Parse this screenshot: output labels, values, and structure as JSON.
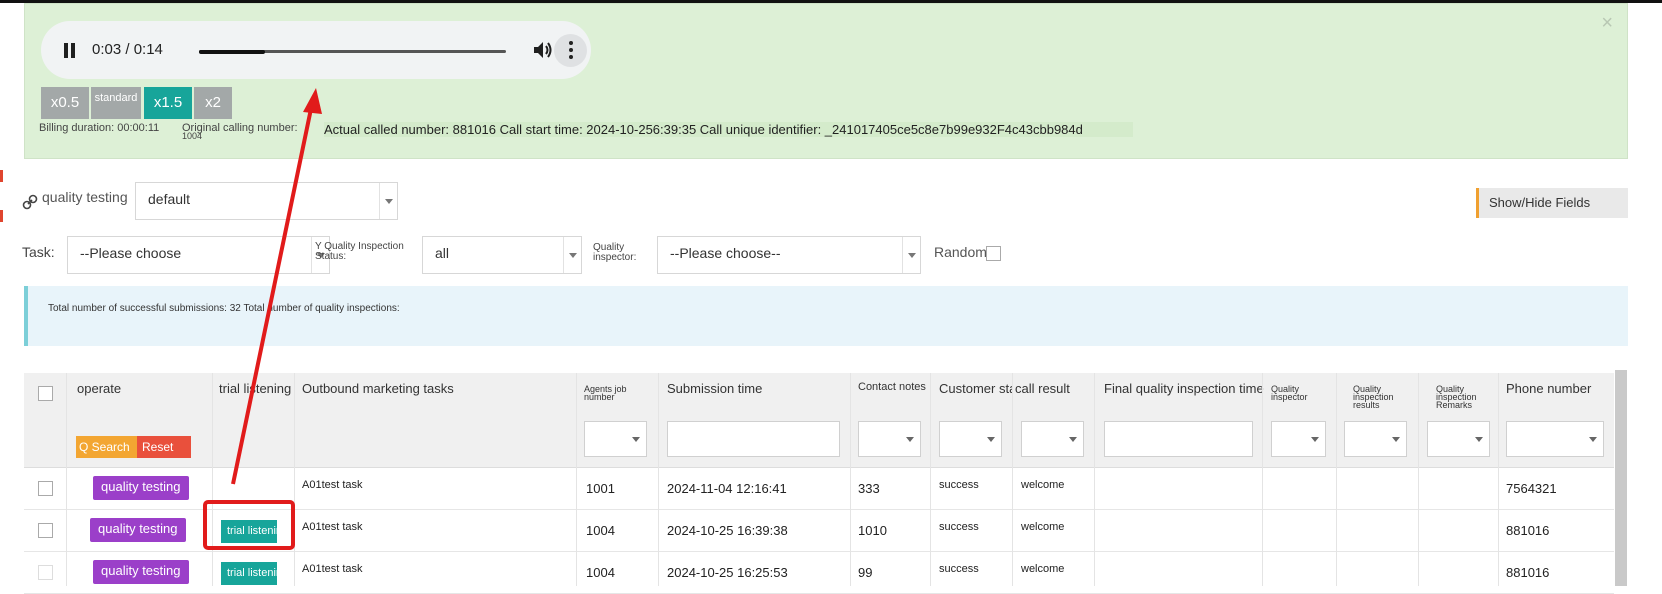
{
  "player": {
    "time": "0:03 / 0:14",
    "progress": 0.214,
    "speeds": [
      "x0.5",
      "standard",
      "x1.5",
      "x2"
    ],
    "billing": "Billing duration: 00:00:11",
    "original_label": "Original calling number:",
    "original_value": "1004",
    "call_info": "Actual called number: 881016 Call start time: 2024-10-256:39:35 Call unique identifier: _241017405ce5c8e7b99e932F4c43cbb984d",
    "close": "×"
  },
  "filters": {
    "qt_label": "quality testing",
    "qt_value": "default",
    "show_hide": "Show/Hide Fields",
    "task_label": "Task:",
    "task_value": "--Please choose",
    "qis_label_1": "Y Quality Inspection",
    "qis_label_2": "Status:",
    "qis_value": "all",
    "qi_label_1": "Quality",
    "qi_label_2": "inspector:",
    "qi_value": "--Please choose--",
    "random_label": "Random:"
  },
  "info": "Total number of successful submissions: 32 Total number of quality inspections:",
  "table": {
    "headers": {
      "operate": "operate",
      "trial": "trial listening",
      "outbound": "Outbound marketing tasks",
      "agents_1": "Agents job",
      "agents_2": "number",
      "submission": "Submission time",
      "contact": "Contact notes",
      "customer": "Customer status",
      "call_result": "call result",
      "final": "Final quality inspection time",
      "qi_1": "Quality",
      "qi_2": "inspector",
      "qres_1": "Quality",
      "qres_2": "inspection",
      "qres_3": "results",
      "qrem_1": "Quality",
      "qrem_2": "inspection",
      "qrem_3": "Remarks",
      "phone": "Phone number"
    },
    "q_search": "Q Search",
    "reset": "Reset",
    "rows": [
      {
        "op": "quality testing",
        "trial": "",
        "task": "A01test task",
        "agent": "1001",
        "time": "2024-11-04 12:16:41",
        "notes": "333",
        "status": "success",
        "result": "welcome",
        "phone": "7564321"
      },
      {
        "op": "quality testing",
        "trial": "trial listening",
        "task": "A01test task",
        "agent": "1004",
        "time": "2024-10-25 16:39:38",
        "notes": "1010",
        "status": "success",
        "result": "welcome",
        "phone": "881016"
      },
      {
        "op": "quality testing",
        "trial": "trial listening",
        "task": "A01test task",
        "agent": "1004",
        "time": "2024-10-25 16:25:53",
        "notes": "99",
        "status": "success",
        "result": "welcome",
        "phone": "881016"
      }
    ]
  },
  "colors": {
    "panel_green": "#ddf0d6",
    "teal": "#17a59a",
    "purple": "#9b3fc9",
    "orange": "#f3a632",
    "red": "#e9503c",
    "annotation_red": "#e11b1b"
  }
}
